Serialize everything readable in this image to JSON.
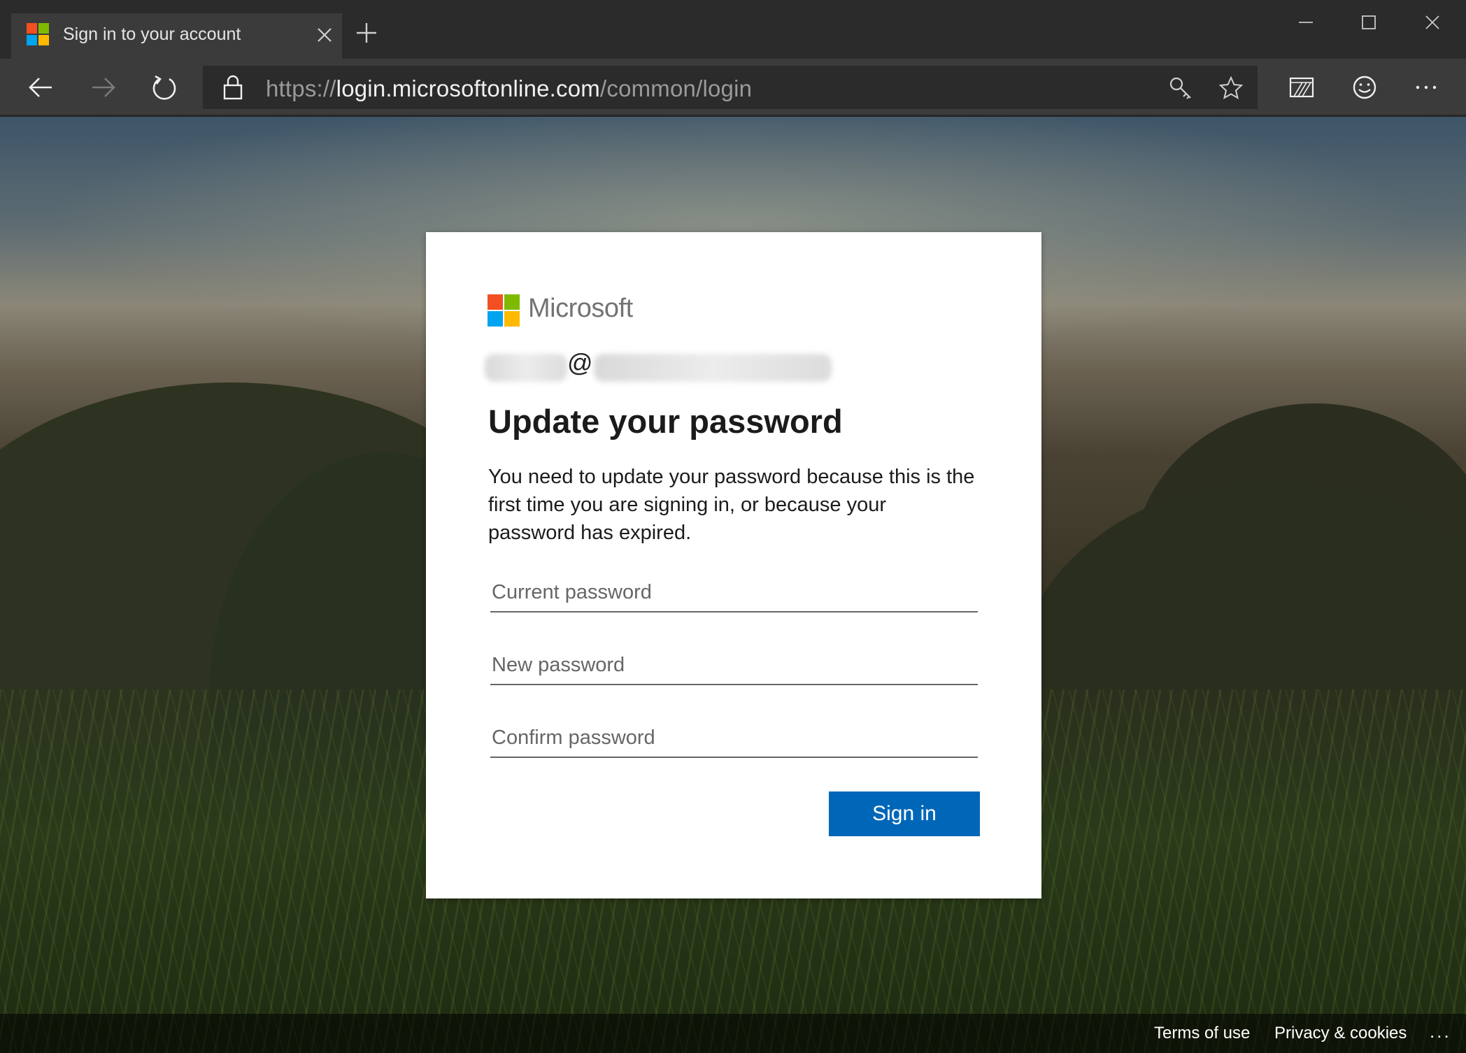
{
  "browser": {
    "tab": {
      "title": "Sign in to your account",
      "favicon_colors": [
        "#f25022",
        "#7fba00",
        "#00a4ef",
        "#ffb900"
      ]
    },
    "url": {
      "scheme": "https://",
      "host": "login.microsoftonline.com",
      "path": "/common/login"
    },
    "icons": {
      "back": "arrow-left-icon",
      "forward": "arrow-right-icon",
      "refresh": "refresh-icon",
      "lock": "lock-icon",
      "key": "key-icon",
      "favorite": "star-icon",
      "reading_view": "reading-view-icon",
      "feedback": "smiley-icon",
      "more": "more-icon"
    }
  },
  "card": {
    "brand": "Microsoft",
    "account": {
      "at_symbol": "@",
      "redacted": true
    },
    "heading": "Update your password",
    "description": "You need to update your password because this is the first time you are signing in, or because your password has expired.",
    "fields": {
      "current_password_placeholder": "Current password",
      "new_password_placeholder": "New password",
      "confirm_password_placeholder": "Confirm password"
    },
    "submit_label": "Sign in",
    "accent_color": "#0067b8"
  },
  "footer": {
    "terms": "Terms of use",
    "privacy": "Privacy & cookies",
    "more": "..."
  }
}
